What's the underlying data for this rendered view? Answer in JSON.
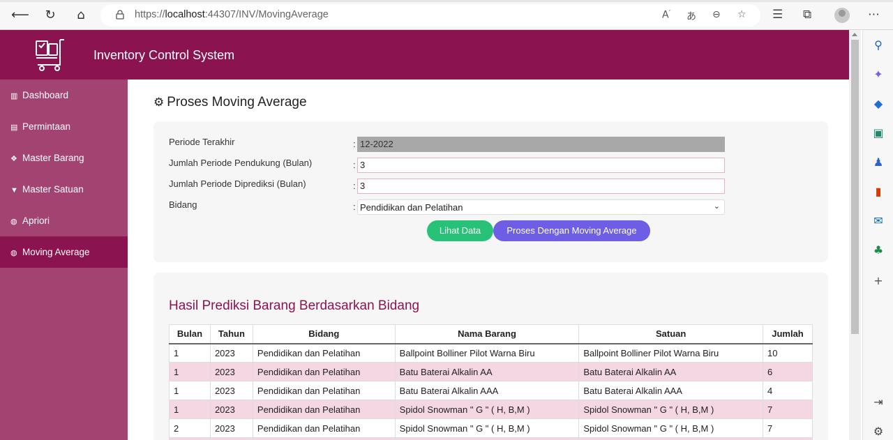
{
  "browser": {
    "url_prefix": "https://",
    "url_host": "localhost",
    "url_rest": ":44307/INV/MovingAverage"
  },
  "app": {
    "title": "Inventory Control System",
    "brand_color": "#8b1450",
    "sidebar_color": "#a34371"
  },
  "sidebar": {
    "items": [
      {
        "label": "Dashboard",
        "icon": "bar-chart-icon",
        "glyph": "▥"
      },
      {
        "label": "Permintaan",
        "icon": "book-icon",
        "glyph": "▤"
      },
      {
        "label": "Master Barang",
        "icon": "cubes-icon",
        "glyph": "❖"
      },
      {
        "label": "Master Satuan",
        "icon": "filter-icon",
        "glyph": "▼"
      },
      {
        "label": "Apriori",
        "icon": "globe-icon",
        "glyph": "◍"
      },
      {
        "label": "Moving Average",
        "icon": "globe-icon",
        "glyph": "◍",
        "active": true
      }
    ]
  },
  "main": {
    "page_title": "Proses Moving Average",
    "form": {
      "periode_label": "Periode Terakhir",
      "periode_value": "12-2022",
      "pendukung_label": "Jumlah Periode Pendukung (Bulan)",
      "pendukung_value": "3",
      "diprediksi_label": "Jumlah Periode Diprediksi (Bulan)",
      "diprediksi_value": "3",
      "bidang_label": "Bidang",
      "bidang_value": "Pendidikan dan Pelatihan",
      "colon": ":"
    },
    "buttons": {
      "lihat": "Lihat Data",
      "proses": "Proses Dengan Moving Average"
    },
    "result": {
      "title": "Hasil Prediksi Barang Berdasarkan Bidang",
      "headers": [
        "Bulan",
        "Tahun",
        "Bidang",
        "Nama Barang",
        "Satuan",
        "Jumlah"
      ],
      "rows": [
        [
          "1",
          "2023",
          "Pendidikan dan Pelatihan",
          "Ballpoint Bolliner Pilot Warna Biru",
          "Ballpoint Bolliner Pilot Warna Biru",
          "10"
        ],
        [
          "1",
          "2023",
          "Pendidikan dan Pelatihan",
          "Batu Baterai Alkalin AA",
          "Batu Baterai Alkalin AA",
          "6"
        ],
        [
          "1",
          "2023",
          "Pendidikan dan Pelatihan",
          "Batu Baterai Alkalin AAA",
          "Batu Baterai Alkalin AAA",
          "4"
        ],
        [
          "1",
          "2023",
          "Pendidikan dan Pelatihan",
          "Spidol Snowman \" G \" ( H, B,M )",
          "Spidol Snowman \" G \" ( H, B,M )",
          "7"
        ],
        [
          "2",
          "2023",
          "Pendidikan dan Pelatihan",
          "Spidol Snowman \" G \" ( H, B,M )",
          "Spidol Snowman \" G \" ( H, B,M )",
          "7"
        ]
      ]
    }
  }
}
